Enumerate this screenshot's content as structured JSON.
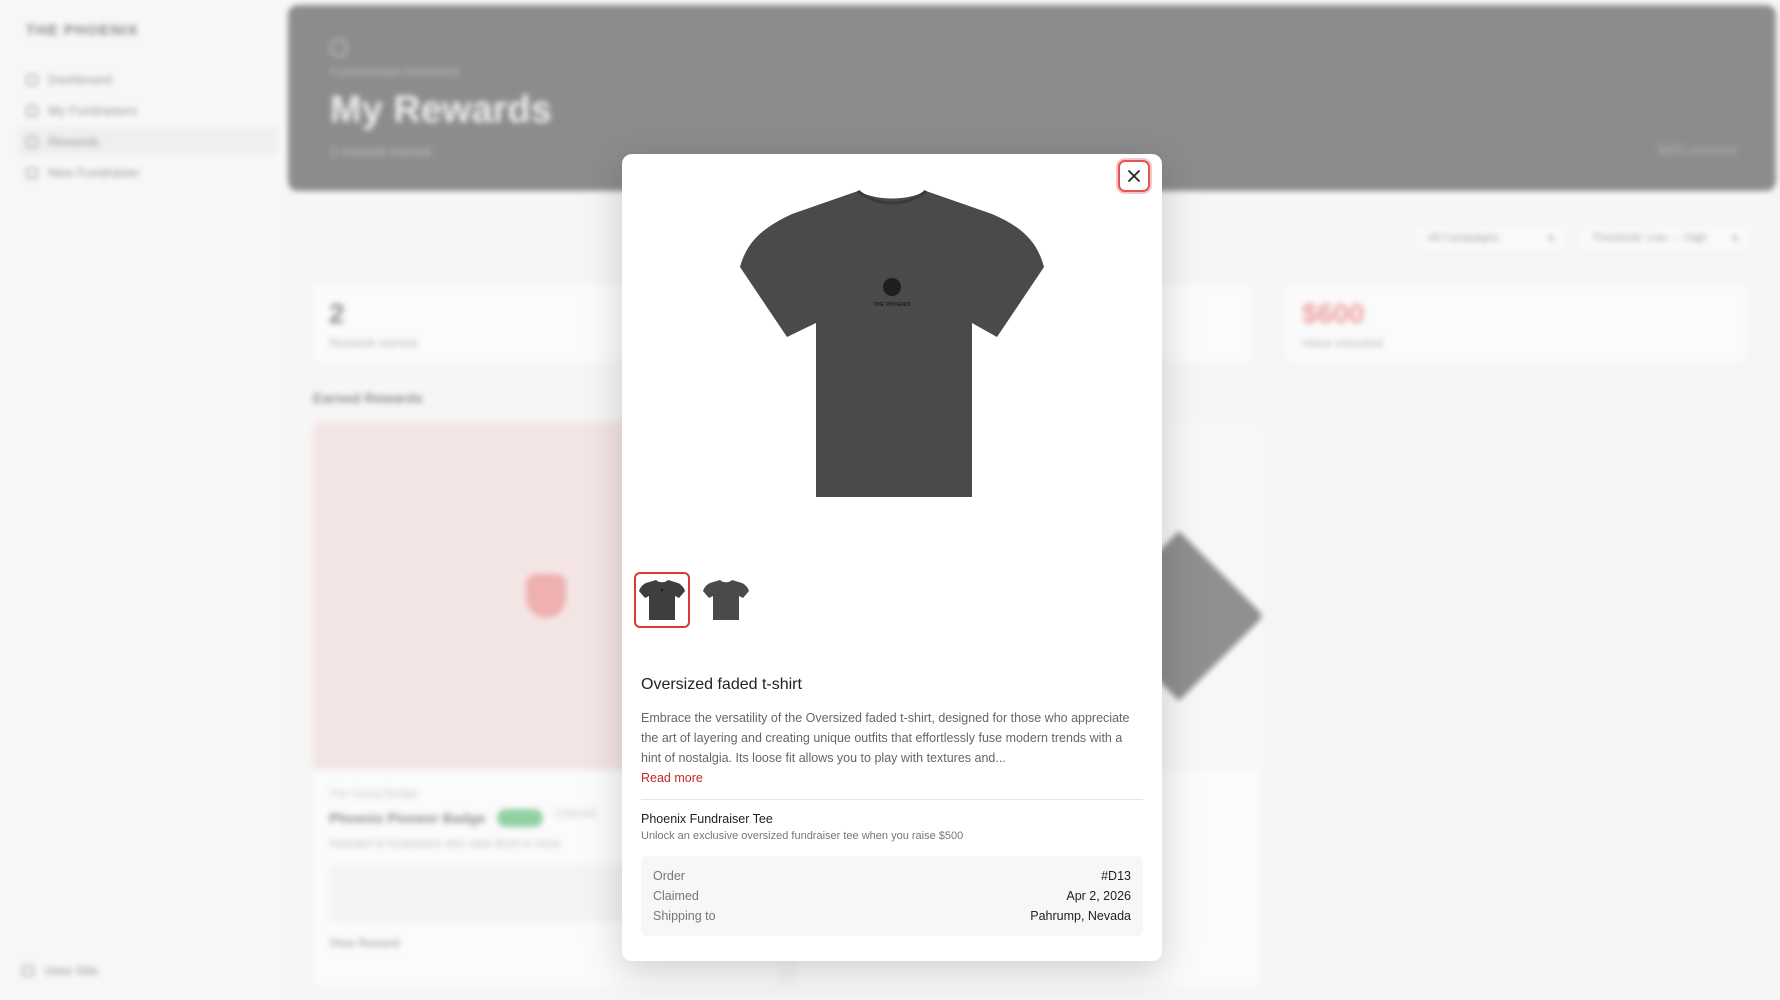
{
  "sidebar": {
    "brand": "THE PHOENIX",
    "items": [
      {
        "label": "Dashboard"
      },
      {
        "label": "My Fundraisers"
      },
      {
        "label": "Rewards"
      },
      {
        "label": "New Fundraiser"
      }
    ],
    "footer_label": "View Site"
  },
  "hero": {
    "breadcrumb": "FUNDRAISER REWARDS",
    "title": "My Rewards",
    "subtitle": "2 rewards earned",
    "right_text": "$600 unlocked"
  },
  "filters": {
    "campaigns": "All Campaigns",
    "sort": "Threshold: Low → High"
  },
  "stats": [
    {
      "value": "2",
      "label": "Rewards earned"
    },
    {
      "value": "$600",
      "label": "Value unlocked"
    }
  ],
  "section_title": "Earned Rewards",
  "background_card": {
    "small": "The Giving Bridge",
    "title": "Phoenix Pioneer Badge",
    "status": "Claimed",
    "desc": "Awarded to fundraisers who raise $100 or more",
    "button": "View Reward"
  },
  "modal": {
    "close_icon": "close-icon",
    "image_alt": "Oversized faded t-shirt",
    "logo_text": "THE PHOENIX",
    "product_title": "Oversized faded t-shirt",
    "description": "Embrace the versatility of the Oversized faded t-shirt, designed for those who appreciate the art of layering and creating unique outfits that effortlessly fuse modern trends with a hint of nostalgia. Its loose fit allows you to play with textures and...",
    "read_more": "Read more",
    "reward_name": "Phoenix Fundraiser Tee",
    "reward_desc": "Unlock an exclusive oversized fundraiser tee when you raise $500",
    "order": {
      "order_label": "Order",
      "order_value": "#D13",
      "claimed_label": "Claimed",
      "claimed_value": "Apr 2, 2026",
      "shipping_label": "Shipping to",
      "shipping_value": "Pahrump, Nevada"
    }
  },
  "colors": {
    "accent": "#d63a3a",
    "shirt": "#444444",
    "hero_bg": "#2f2f2f"
  }
}
